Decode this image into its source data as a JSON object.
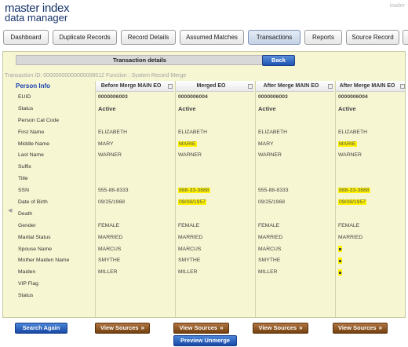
{
  "header": {
    "logo_line1": "master index",
    "logo_line2": "data manager",
    "loader": "loader"
  },
  "tabs": [
    {
      "label": "Dashboard"
    },
    {
      "label": "Duplicate Records"
    },
    {
      "label": "Record Details"
    },
    {
      "label": "Assumed Matches"
    },
    {
      "label": "Transactions",
      "active": true
    },
    {
      "label": "Reports"
    },
    {
      "label": "Source Record"
    }
  ],
  "transaction": {
    "title": "Transaction details",
    "back_label": "Back",
    "info": "Transaction ID: 00000000000000008012  Function : System Record Merge"
  },
  "fields": {
    "header": "Person Info",
    "labels": [
      "EUID",
      "Status",
      "Person Cat Code",
      "First Name",
      "Middle Name",
      "Last Name",
      "Suffix",
      "Title",
      "SSN",
      "Date of Birth",
      "Death",
      "Gender",
      "Marital Status",
      "Spouse Name",
      "Mother Maiden Name",
      "Maiden",
      "VIP Flag",
      "Status"
    ]
  },
  "columns": [
    {
      "header": "Before Merge MAIN EO",
      "values": [
        "0000006003",
        "Active",
        "",
        "ELIZABETH",
        "MARY",
        "WARNER",
        "",
        "",
        "555-88-8333",
        "09/25/1968",
        "",
        "FEMALE",
        "MARRIED",
        "MARCUS",
        "SMYTHE",
        "MILLER",
        "",
        ""
      ],
      "highlight": []
    },
    {
      "header": "Merged EO",
      "values": [
        "0000006004",
        "Active",
        "",
        "ELIZABETH",
        "MARIE",
        "WARNER",
        "",
        "",
        "888-33-3888",
        "09/08/1957",
        "",
        "FEMALE",
        "MARRIED",
        "MARCUS",
        "SMYTHE",
        "MILLER",
        "",
        ""
      ],
      "highlight": [
        4,
        8,
        9
      ]
    },
    {
      "header": "After Merge MAIN EO",
      "values": [
        "0000006003",
        "Active",
        "",
        "ELIZABETH",
        "MARY",
        "WARNER",
        "",
        "",
        "555-88-8333",
        "09/25/1968",
        "",
        "FEMALE",
        "MARRIED",
        "MARCUS",
        "SMYTHE",
        "MILLER",
        "",
        ""
      ],
      "highlight": []
    },
    {
      "header": "After Merge MAIN EO",
      "values": [
        "0000006004",
        "Active",
        "",
        "ELIZABETH",
        "MARIE",
        "WARNER",
        "",
        "",
        "888-33-3888",
        "09/08/1957",
        "",
        "FEMALE",
        "MARRIED",
        "",
        "",
        "",
        "",
        ""
      ],
      "highlight": [
        4,
        8,
        9
      ],
      "dots": [
        13,
        14,
        15
      ]
    }
  ],
  "actions": {
    "search_again": "Search Again",
    "view_sources": "View Sources",
    "preview_unmerge": "Preview Unmerge"
  },
  "colors": {
    "highlight": "#fff200",
    "panel_bg": "#f6f6d2",
    "accent_blue": "#1a3fb0",
    "button_brown": "#8a4f1c"
  }
}
